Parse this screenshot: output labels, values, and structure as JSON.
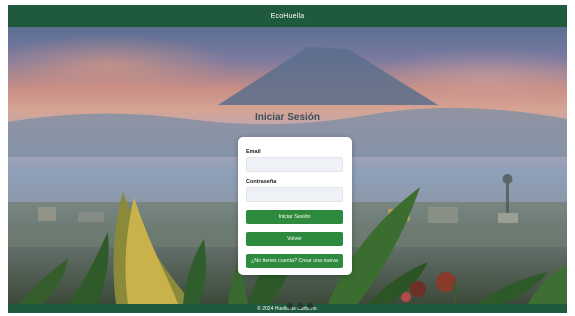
{
  "header": {
    "brand": "EcoHuella"
  },
  "page": {
    "title": "Iniciar Sesión"
  },
  "form": {
    "email_label": "Email",
    "email_value": "",
    "password_label": "Contraseña",
    "password_value": "",
    "login_button": "Iniciar Sesión",
    "back_button": "Volver",
    "signup_button": "¿No tienes cuenta? Crear una nueva"
  },
  "footer": {
    "copyright": "© 2024 Huella de Carbono."
  },
  "colors": {
    "header_bg": "#1f5a3e",
    "button_bg": "#2e8b3e",
    "title_text": "#3d4e5a"
  },
  "icons": {
    "background": "volcano-landscape-photo"
  }
}
